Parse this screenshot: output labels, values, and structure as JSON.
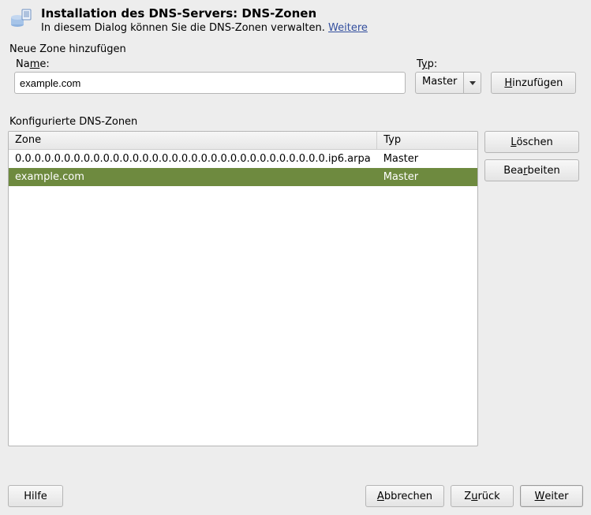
{
  "header": {
    "title": "Installation des DNS-Servers: DNS-Zonen",
    "subtitle_prefix": "In diesem Dialog können Sie die DNS-Zonen verwalten. ",
    "subtitle_link": "Weitere"
  },
  "new_zone": {
    "group_label": "Neue Zone hinzufügen",
    "name_label_pre": "Na",
    "name_label_u": "m",
    "name_label_post": "e:",
    "name_value": "example.com",
    "type_label_pre": "T",
    "type_label_u": "y",
    "type_label_post": "p:",
    "type_value": "Master",
    "add_btn_u": "H",
    "add_btn_post": "inzufügen"
  },
  "zones": {
    "group_label": "Konfigurierte DNS-Zonen",
    "col_zone": "Zone",
    "col_typ": "Typ",
    "rows": [
      {
        "zone": "0.0.0.0.0.0.0.0.0.0.0.0.0.0.0.0.0.0.0.0.0.0.0.0.0.0.0.0.0.0.0.0.ip6.arpa",
        "typ": "Master",
        "selected": false
      },
      {
        "zone": "example.com",
        "typ": "Master",
        "selected": true
      }
    ],
    "delete_btn_u": "L",
    "delete_btn_post": "öschen",
    "edit_btn_pre": "Bea",
    "edit_btn_u": "r",
    "edit_btn_post": "beiten"
  },
  "footer": {
    "help": "Hilfe",
    "abort_u": "A",
    "abort_post": "bbrechen",
    "back_pre": "Z",
    "back_u": "u",
    "back_post": "rück",
    "next_u": "W",
    "next_post": "eiter"
  }
}
